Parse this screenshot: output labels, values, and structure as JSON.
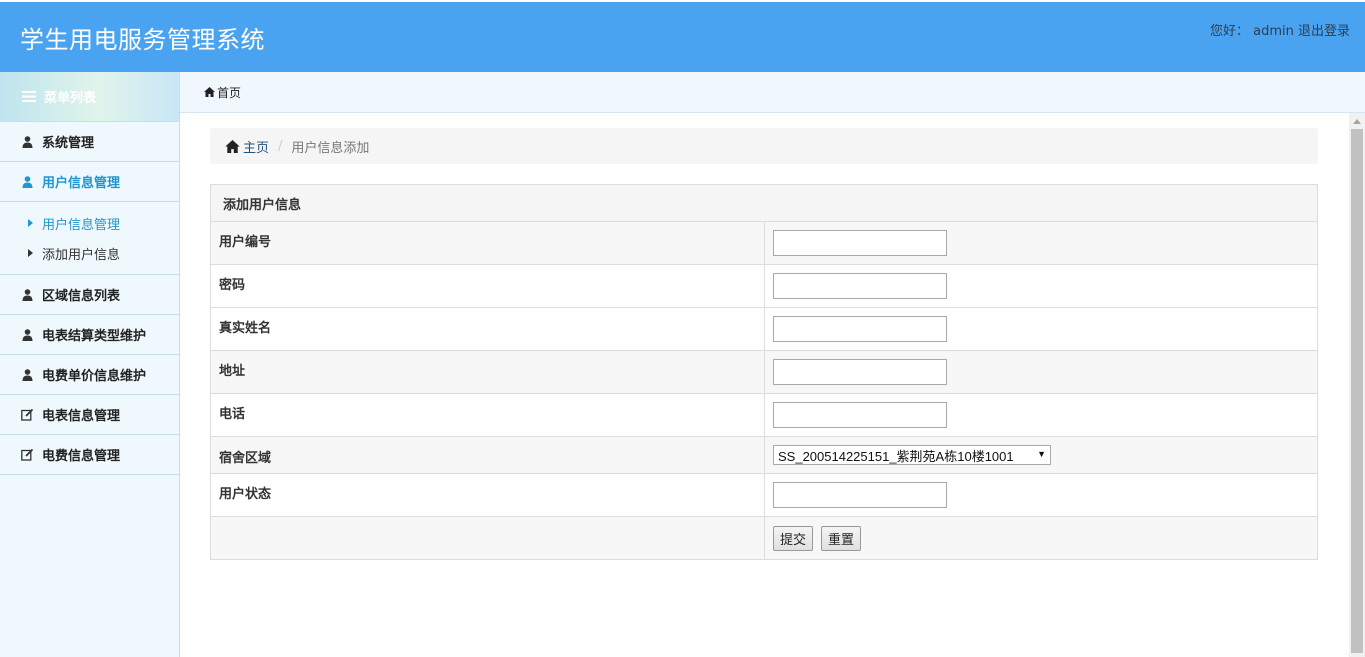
{
  "header": {
    "title": "学生用电服务管理系统",
    "greeting": "您好：",
    "username": "admin",
    "logout": "退出登录",
    "bg_color": "#4aa3f0"
  },
  "sidebar": {
    "menu_title": "菜单列表",
    "items": [
      {
        "label": "系统管理",
        "icon": "user-icon"
      },
      {
        "label": "用户信息管理",
        "icon": "user-icon",
        "active": true,
        "children": [
          {
            "label": "用户信息管理",
            "active": true
          },
          {
            "label": "添加用户信息"
          }
        ]
      },
      {
        "label": "区域信息列表",
        "icon": "user-icon"
      },
      {
        "label": "电表结算类型维护",
        "icon": "user-icon"
      },
      {
        "label": "电费单价信息维护",
        "icon": "user-icon"
      },
      {
        "label": "电表信息管理",
        "icon": "edit-icon"
      },
      {
        "label": "电费信息管理",
        "icon": "edit-icon"
      }
    ],
    "active_color": "#1d96d1"
  },
  "tabbar": {
    "home_tab": "首页"
  },
  "breadcrumb": {
    "home": "主页",
    "current": "用户信息添加"
  },
  "form": {
    "title": "添加用户信息",
    "fields": [
      {
        "label": "用户编号",
        "value": ""
      },
      {
        "label": "密码",
        "value": ""
      },
      {
        "label": "真实姓名",
        "value": ""
      },
      {
        "label": "地址",
        "value": ""
      },
      {
        "label": "电话",
        "value": ""
      },
      {
        "label": "宿舍区域",
        "selected": "SS_200514225151_紫荆苑A栋10楼1001"
      },
      {
        "label": "用户状态",
        "value": ""
      }
    ],
    "submit": "提交",
    "reset": "重置"
  }
}
